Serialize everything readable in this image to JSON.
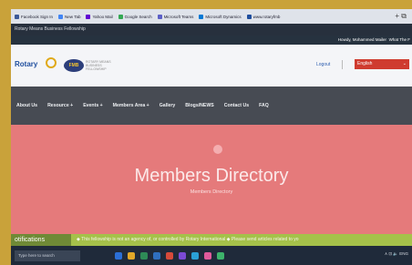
{
  "browser": {
    "bookmarks": [
      {
        "label": "Facebook Sign In",
        "color": "#3b5998"
      },
      {
        "label": "New Tab",
        "color": "#4285f4"
      },
      {
        "label": "Yahoo Mail",
        "color": "#6001d2"
      },
      {
        "label": "Google Search",
        "color": "#34a853"
      },
      {
        "label": "Microsoft Teams",
        "color": "#5b5fc7"
      },
      {
        "label": "Microsoft Dynamics",
        "color": "#0078d4"
      },
      {
        "label": "www.rotaryfmb",
        "color": "#1f4e9e"
      }
    ],
    "window_controls": "+  ⧉"
  },
  "window": {
    "title": "Rotary Means Business Fellowship"
  },
  "site_top": {
    "user": "Howdy, Mohammed Mailer",
    "whatsnew": "What The F"
  },
  "header": {
    "rotary_label": "Rotary",
    "fmb_logo": "FMB",
    "fmb_text": "ROTARY MEANS BUSINESS FELLOWSHIP",
    "logout": "Logout",
    "language": "English"
  },
  "nav": {
    "items": [
      "About Us",
      "Resource +",
      "Events +",
      "Members Area +",
      "Gallery",
      "Blogs/NEWS",
      "Contact Us",
      "FAQ"
    ]
  },
  "hero": {
    "title": "Members Directory",
    "breadcrumb": "Members Directory"
  },
  "ticker": {
    "label": "otifications",
    "text": "◆ This fellowship is not an agency of, or controlled by Rotary International ◆ Please send articles related to yo"
  },
  "taskbar": {
    "search": "Type here to search",
    "tray": "∧ ⊡ 🔈 ENG",
    "icons": [
      "#2b6fd6",
      "#e2a829",
      "#2e8b57",
      "#2f6fbf",
      "#d64a3a",
      "#7b4ad6",
      "#2aa0d6",
      "#e05a9c",
      "#3db36b"
    ]
  },
  "colors": {
    "hero_bg": "#e57a7b",
    "nav_bg": "#474b53",
    "ticker_bg": "#a5c14a",
    "lang_bg": "#cf3b2f"
  }
}
